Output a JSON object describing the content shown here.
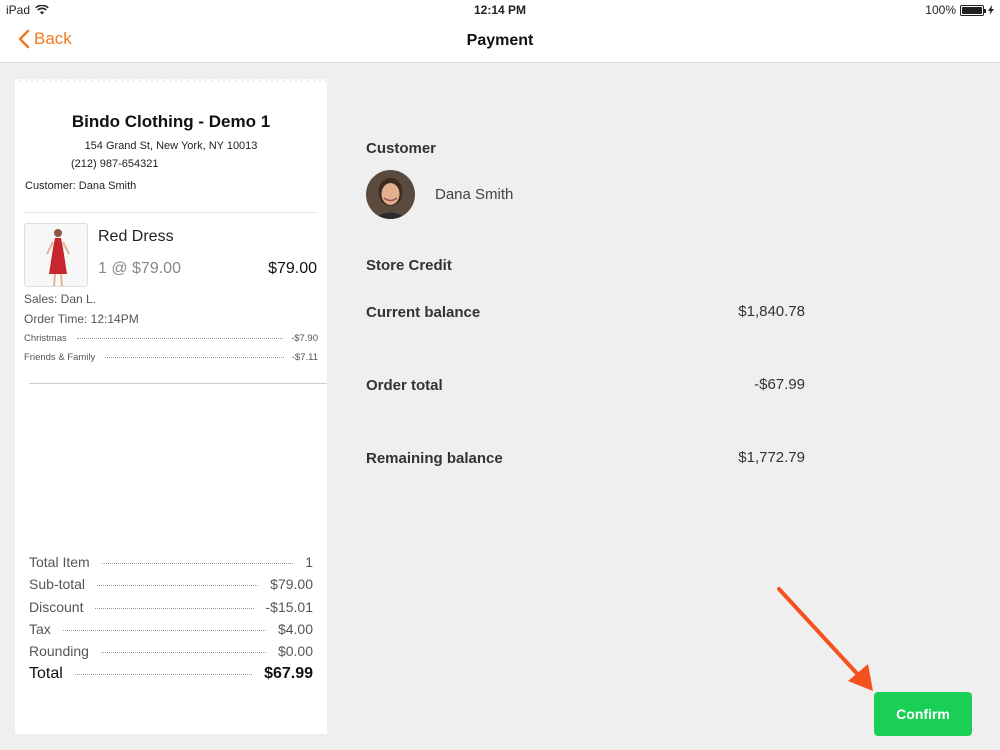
{
  "status_bar": {
    "device": "iPad",
    "time": "12:14 PM",
    "battery": "100%"
  },
  "nav": {
    "back_label": "Back",
    "title": "Payment"
  },
  "receipt": {
    "store_name": "Bindo Clothing - Demo 1",
    "address": "154 Grand St, New York, NY 10013",
    "phone": "(212) 987-654321",
    "customer": "Customer: Dana Smith",
    "item": {
      "name": "Red Dress",
      "qty_price": "1 @ $79.00",
      "price": "$79.00"
    },
    "sales": "Sales: Dan L.",
    "order_time": "Order Time: 12:14PM",
    "discounts": [
      {
        "label": "Christmas",
        "value": "-$7.90"
      },
      {
        "label": "Friends & Family",
        "value": "-$7.11"
      }
    ],
    "summary": [
      {
        "label": "Total Item",
        "value": "1"
      },
      {
        "label": "Sub-total",
        "value": "$79.00"
      },
      {
        "label": "Discount",
        "value": "-$15.01"
      },
      {
        "label": "Tax",
        "value": "$4.00"
      },
      {
        "label": "Rounding",
        "value": "$0.00"
      },
      {
        "label": "Total",
        "value": "$67.99"
      }
    ]
  },
  "payment": {
    "customer_heading": "Customer",
    "customer_name": "Dana Smith",
    "store_credit_heading": "Store Credit",
    "current_balance_label": "Current balance",
    "current_balance": "$1,840.78",
    "order_total_label": "Order total",
    "order_total": "-$67.99",
    "remaining_balance_label": "Remaining balance",
    "remaining_balance": "$1,772.79"
  },
  "confirm_label": "Confirm",
  "colors": {
    "accent": "#f07a22",
    "confirm": "#19cf55",
    "arrow": "#f4511e"
  }
}
